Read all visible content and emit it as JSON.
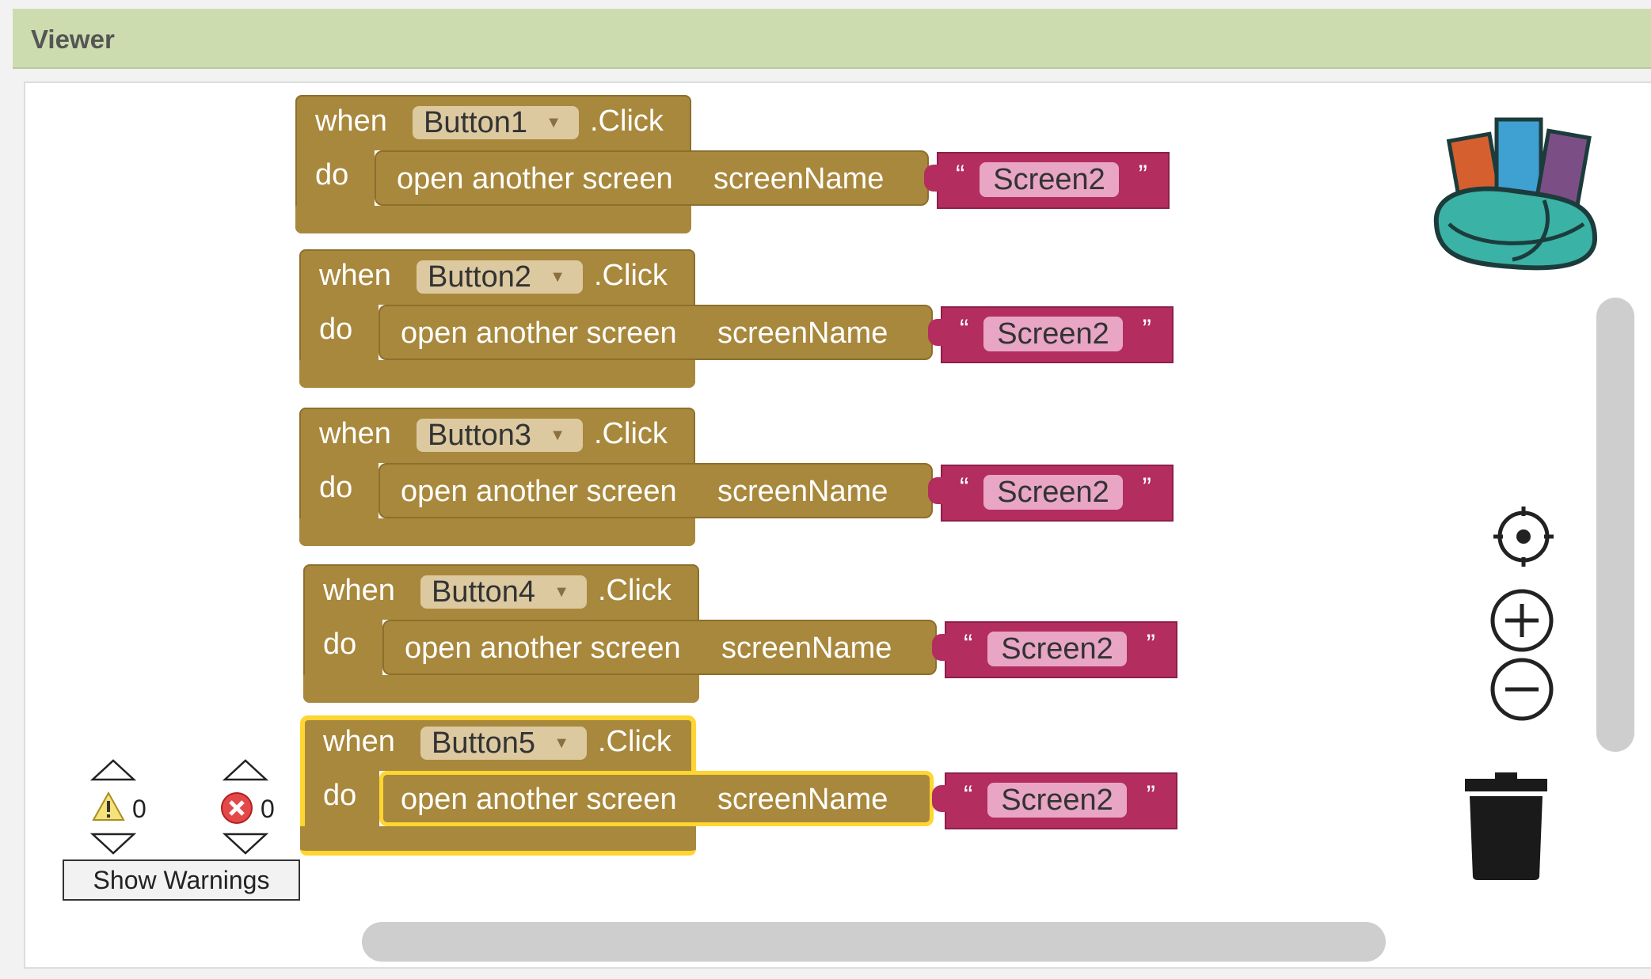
{
  "header": {
    "title": "Viewer"
  },
  "blocks": [
    {
      "when": "when",
      "component": "Button1",
      "event": ".Click",
      "do": "do",
      "call": "open another screen",
      "arg": "screenName",
      "value": "Screen2",
      "quote_open": "“",
      "quote_close": "”"
    },
    {
      "when": "when",
      "component": "Button2",
      "event": ".Click",
      "do": "do",
      "call": "open another screen",
      "arg": "screenName",
      "value": "Screen2",
      "quote_open": "“",
      "quote_close": "”"
    },
    {
      "when": "when",
      "component": "Button3",
      "event": ".Click",
      "do": "do",
      "call": "open another screen",
      "arg": "screenName",
      "value": "Screen2",
      "quote_open": "“",
      "quote_close": "”"
    },
    {
      "when": "when",
      "component": "Button4",
      "event": ".Click",
      "do": "do",
      "call": "open another screen",
      "arg": "screenName",
      "value": "Screen2",
      "quote_open": "“",
      "quote_close": "”"
    },
    {
      "when": "when",
      "component": "Button5",
      "event": ".Click",
      "do": "do",
      "call": "open another screen",
      "arg": "screenName",
      "value": "Screen2",
      "quote_open": "“",
      "quote_close": "”"
    }
  ],
  "warnings": {
    "warning_count": "0",
    "error_count": "0",
    "button_label": "Show Warnings"
  },
  "icons": {
    "backpack": "backpack-icon",
    "center": "target-icon",
    "zoom_in": "zoom-in-icon",
    "zoom_out": "zoom-out-icon",
    "trash": "trash-icon"
  },
  "colors": {
    "header": "#cddcae",
    "event_block": "#a8883c",
    "text_block": "#b32d5e",
    "selected_outline": "#ffd531"
  }
}
